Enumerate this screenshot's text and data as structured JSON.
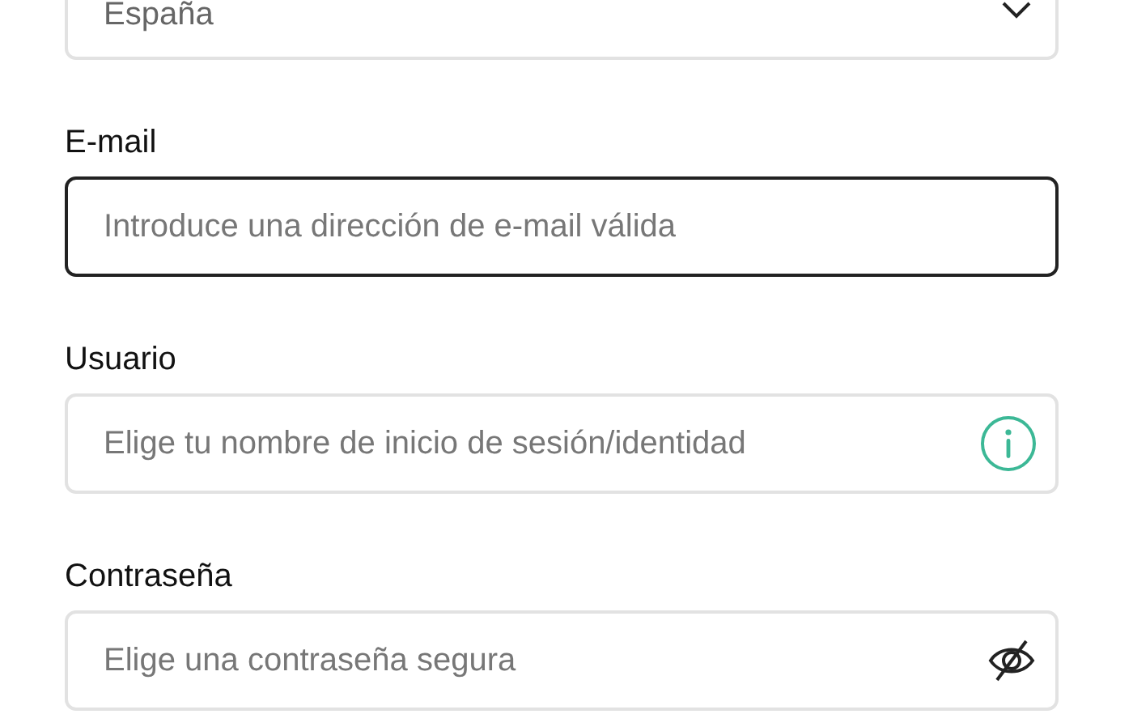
{
  "fields": [
    {
      "kind": "select",
      "value": "España",
      "focused": false
    },
    {
      "kind": "text",
      "label": "E-mail",
      "placeholder": "Introduce una dirección de e-mail válida",
      "focused": true
    },
    {
      "kind": "info",
      "label": "Usuario",
      "placeholder": "Elige tu nombre de inicio de sesión/identidad",
      "focused": false
    },
    {
      "kind": "password",
      "label": "Contraseña",
      "placeholder": "Elige una contraseña segura",
      "focused": false
    }
  ]
}
